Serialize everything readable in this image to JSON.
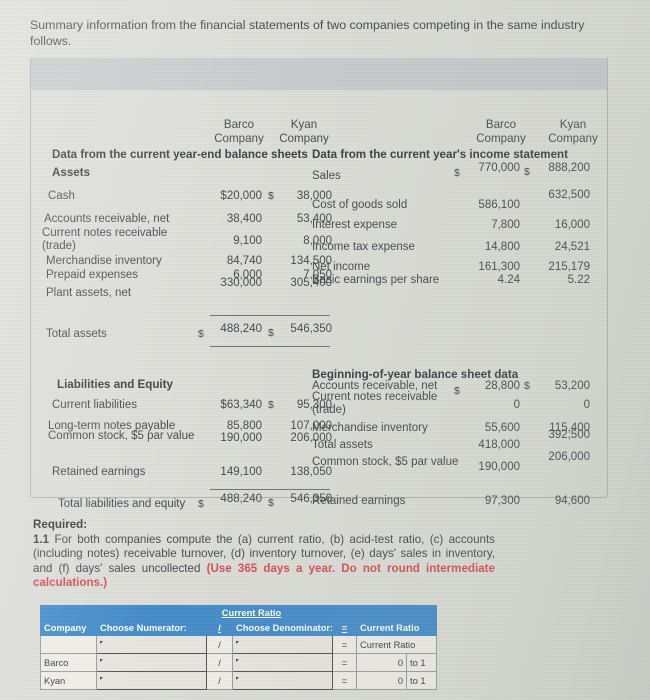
{
  "intro": "Summary information from the financial statements of two companies competing in the same industry follows.",
  "columns": {
    "barco_line1": "Barco",
    "barco_line2": "Company",
    "kyan_line1": "Kyan",
    "kyan_line2": "Company"
  },
  "left_panel": {
    "title": "Data from the current year-end balance sheets",
    "assets_heading": "Assets",
    "asset_rows": [
      {
        "label": "Cash",
        "barco": "$20,000",
        "kyan": "38,000",
        "kyan_dollar": "$"
      },
      {
        "label": "Accounts receivable, net",
        "barco": "38,400",
        "kyan": "53,400"
      },
      {
        "label": "Current notes receivable (trade)",
        "barco": "9,100",
        "kyan": "8,000"
      },
      {
        "label": "Merchandise inventory",
        "barco": "84,740",
        "kyan": "134,500"
      },
      {
        "label": "Prepaid expenses",
        "barco": "6,000",
        "kyan": "7,050"
      },
      {
        "label": "Plant assets, net",
        "barco": "330,000",
        "kyan": "305,400"
      }
    ],
    "total_assets": {
      "label": "Total assets",
      "barco": "488,240",
      "kyan": "546,350",
      "barco_dollar": "$",
      "kyan_dollar": "$"
    },
    "liabilities_heading": "Liabilities and Equity",
    "liability_rows": [
      {
        "label": "Current liabilities",
        "barco": "$63,340",
        "kyan": "95,300",
        "kyan_dollar": "$"
      },
      {
        "label": "Long-term notes payable",
        "barco": "85,800",
        "kyan": "107,000"
      },
      {
        "label": "Common stock, $5 par value",
        "barco": "190,000",
        "kyan": "206,000"
      },
      {
        "label": "Retained earnings",
        "barco": "149,100",
        "kyan": "138,050"
      }
    ],
    "total_liab": {
      "label": "Total liabilities and equity",
      "barco": "488,240",
      "kyan": "546,350",
      "barco_dollar": "$",
      "kyan_dollar": "$"
    }
  },
  "right_panel": {
    "title": "Data from the current year's income statement",
    "income_rows": [
      {
        "label": "Sales",
        "barco": "770,000",
        "kyan": "888,200",
        "barco_dollar": "$",
        "kyan_dollar": "$"
      },
      {
        "label": "Cost of goods sold",
        "barco": "586,100",
        "kyan": "632,500"
      },
      {
        "label": "Interest expense",
        "barco": "7,800",
        "kyan": "16,000"
      },
      {
        "label": "Income tax expense",
        "barco": "14,800",
        "kyan": "24,521"
      },
      {
        "label": "Net income",
        "barco": "161,300",
        "kyan": "215,179"
      },
      {
        "label": "Basic earnings per share",
        "barco": "4.24",
        "kyan": "5.22"
      }
    ],
    "begin_heading": "Beginning-of-year balance sheet data",
    "begin_rows": [
      {
        "label": "Accounts receivable, net",
        "barco": "28,800",
        "kyan": "53,200",
        "barco_dollar": "$",
        "kyan_dollar": "$"
      },
      {
        "label": "Current notes receivable (trade)",
        "barco": "0",
        "kyan": "0"
      },
      {
        "label": "Merchandise inventory",
        "barco": "55,600",
        "kyan": "115,400"
      },
      {
        "label": "Total assets",
        "barco": "418,000",
        "kyan": "392,500"
      },
      {
        "label": "Common stock, $5 par value",
        "barco": "190,000",
        "kyan": "206,000"
      },
      {
        "label": "Retained earnings",
        "barco": "97,300",
        "kyan": "94,600"
      }
    ]
  },
  "required": {
    "heading": "Required:",
    "number": "1.1",
    "body_part1": "For both companies compute the (a) current ratio, (b) acid-test ratio, (c) accounts (including notes) receivable turnover, (d) inventory turnover, (e) days' sales in inventory, and (f) days' sales uncollected",
    "emphasis": "(Use 365 days a year. Do not round intermediate calculations.)"
  },
  "sheet": {
    "banner": "Current Ratio",
    "headers": {
      "company": "Company",
      "numerator": "Choose Numerator:",
      "slash": "/",
      "denominator": "Choose Denominator:",
      "equals": "=",
      "result": "Current Ratio"
    },
    "rows": [
      {
        "company": "",
        "numerator": "",
        "slash": "/",
        "denominator": "",
        "equals": "=",
        "value": "",
        "unit": "Current Ratio",
        "is_label_row": true
      },
      {
        "company": "Barco",
        "numerator": "",
        "slash": "/",
        "denominator": "",
        "equals": "=",
        "value": "0",
        "unit": "to 1"
      },
      {
        "company": "Kyan",
        "numerator": "",
        "slash": "/",
        "denominator": "",
        "equals": "=",
        "value": "0",
        "unit": "to 1"
      }
    ]
  },
  "colors": {
    "sheet_header_blue": "#2f7fc4",
    "emphasis_red": "#d03a41",
    "band_gray": "#c2c6c8",
    "page_bg": "#d9dad4"
  }
}
